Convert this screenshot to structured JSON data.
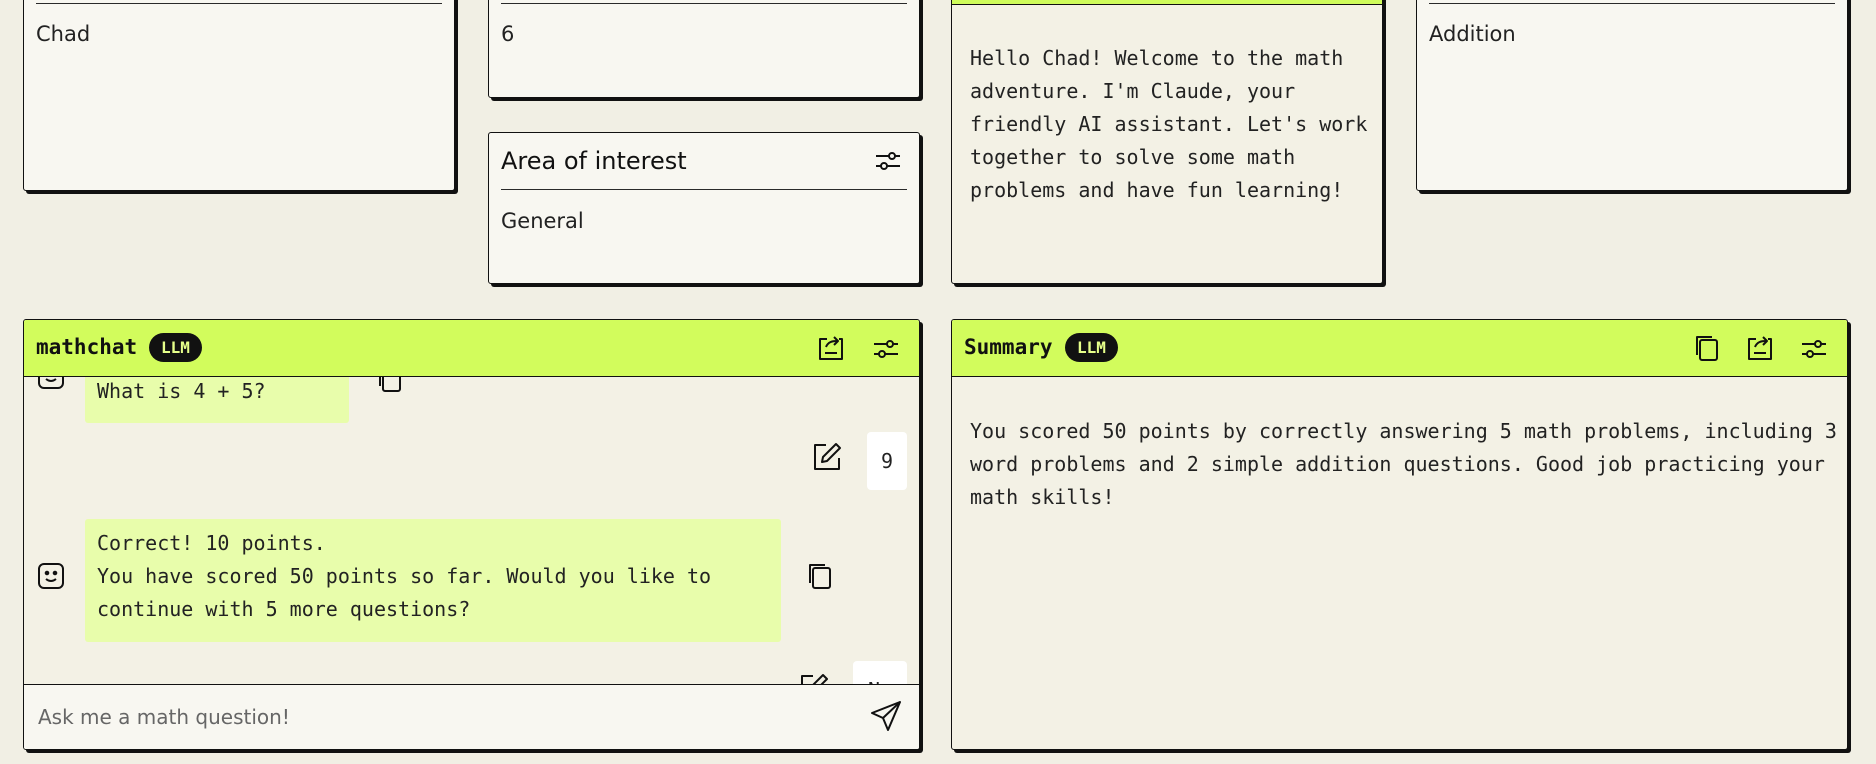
{
  "name_card": {
    "value": "Chad"
  },
  "age_card": {
    "value": "6"
  },
  "interest_card": {
    "title": "Area of interest",
    "value": "General"
  },
  "greeting_card": {
    "text": "Hello Chad! Welcome to the math adventure. I'm Claude, your friendly AI assistant. Let's work together to solve some math problems and have fun learning!"
  },
  "operation_card": {
    "value": "Addition"
  },
  "mathchat": {
    "title": "mathchat",
    "badge": "LLM",
    "messages": [
      {
        "role": "assistant",
        "text": "What is 4 + 5?"
      },
      {
        "role": "user",
        "text": "9"
      },
      {
        "role": "assistant",
        "text": "Correct! 10 points.\nYou have scored 50 points so far. Would you like to continue with 5 more questions?"
      },
      {
        "role": "user",
        "text": "No"
      }
    ],
    "input_placeholder": "Ask me a math question!"
  },
  "summary": {
    "title": "Summary",
    "badge": "LLM",
    "text": "You scored 50 points by correctly answering 5 math problems, including 3 word problems and 2 simple addition questions. Good job practicing your math skills!"
  },
  "colors": {
    "accent": "#d2fc5c",
    "bubble": "#e8fdab",
    "background": "#f1efe4",
    "border": "#111111"
  },
  "icons": [
    "sliders-icon",
    "export-icon",
    "copy-icon",
    "smiley-icon",
    "edit-icon",
    "send-icon"
  ]
}
